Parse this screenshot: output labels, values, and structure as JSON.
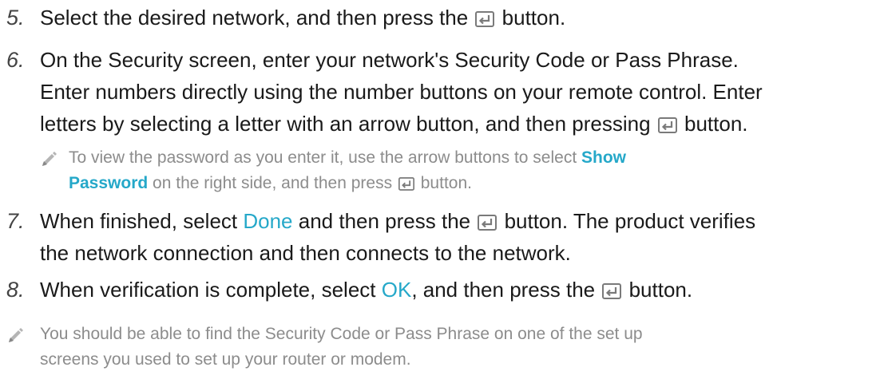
{
  "step5": {
    "number": "5.",
    "before_icon": "Select the desired network, and then press the ",
    "after_icon": " button."
  },
  "step6": {
    "number": "6.",
    "line1": "On the Security screen, enter your network's Security Code or Pass Phrase.",
    "line2": "Enter numbers directly using the number buttons on your remote control. Enter",
    "line3_before_icon": "letters by selecting a letter with an arrow button, and then pressing ",
    "line3_after_icon": " button."
  },
  "note1": {
    "line1_before": "To view the password as you enter it, use the arrow buttons to select ",
    "highlight_part1": "Show",
    "highlight_part2": "Password",
    "line2_after_highlight": " on the right side, and then press ",
    "line2_after_icon": " button."
  },
  "step7": {
    "number": "7.",
    "line1_before": "When finished, select ",
    "highlight": "Done",
    "line1_mid": " and then press the ",
    "line1_after_icon": " button. The product verifies",
    "line2": "the network connection and then connects to the network."
  },
  "step8": {
    "number": "8.",
    "before": "When verification is complete, select ",
    "highlight": "OK",
    "mid": ", and then press the ",
    "after_icon": " button."
  },
  "note2": {
    "line1": "You should be able to find the Security Code or Pass Phrase on one of the set up",
    "line2": "screens you used to set up your router or modem."
  },
  "colors": {
    "text": "#1a1a1a",
    "note_text": "#8c8c8c",
    "highlight": "#25a8c9",
    "icon": "#7a7a7a"
  },
  "icons": {
    "enter": "enter-button-icon",
    "note": "pencil-note-icon"
  }
}
